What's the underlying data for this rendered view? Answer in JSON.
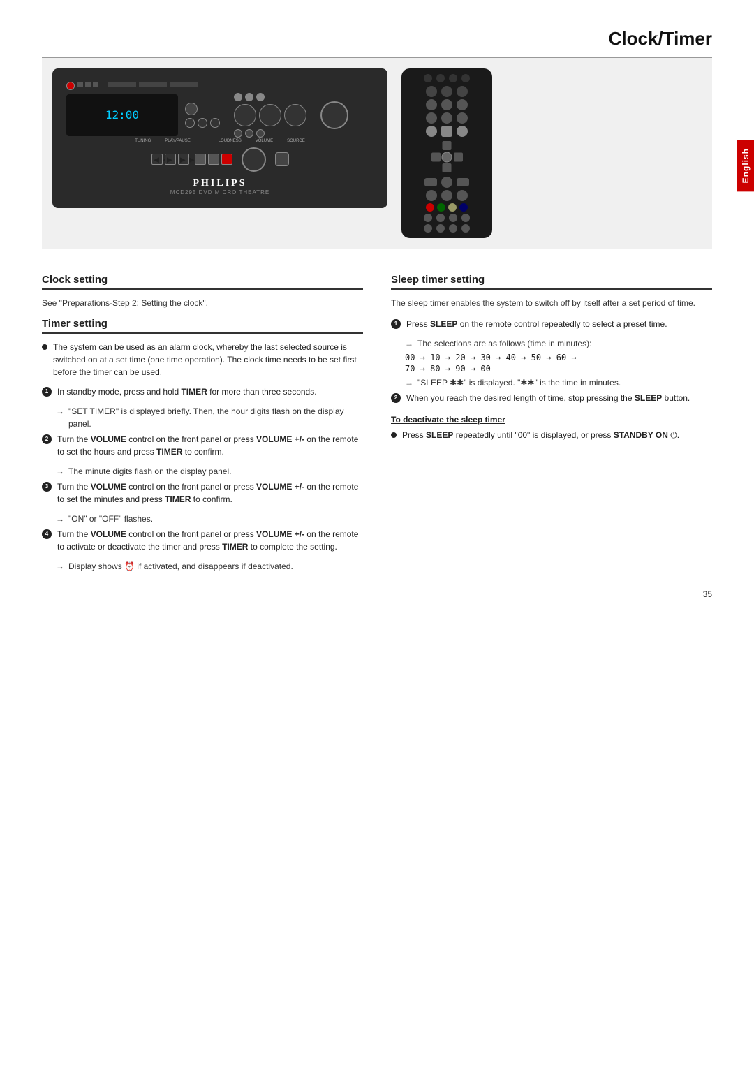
{
  "page": {
    "title": "Clock/Timer",
    "language_tab": "English",
    "page_number": "35"
  },
  "device": {
    "model": "MCD295 DVD MICRO THEATRE",
    "brand": "PHILIPS",
    "display_text": "12:00"
  },
  "clock_setting": {
    "title": "Clock setting",
    "text": "See \"Preparations-Step 2: Setting the clock\"."
  },
  "timer_setting": {
    "title": "Timer setting",
    "bullet0": {
      "text": "The system can be used as an alarm clock, whereby the last selected source is switched on at a set time (one time operation). The clock time needs to be set first before the timer can be used."
    },
    "bullet1": {
      "number": "1",
      "text": "In standby mode, press and hold TIMER for more than three seconds.",
      "arrow1": "→ \"SET TIMER\" is displayed briefly. Then, the hour digits flash on the display panel."
    },
    "bullet2": {
      "number": "2",
      "text": "Turn the VOLUME control on the front panel or press VOLUME +/- on the remote to set the hours and press TIMER to confirm.",
      "arrow1": "→ The minute digits flash on the display panel."
    },
    "bullet3": {
      "number": "3",
      "text": "Turn the VOLUME control on the front panel or press VOLUME +/- on the remote to set the minutes and press TIMER to confirm.",
      "arrow1": "→ \"ON\" or \"OFF\" flashes."
    },
    "bullet4": {
      "number": "4",
      "text": "Turn the VOLUME control on the front panel or press VOLUME +/- on the remote to activate or deactivate the timer and press TIMER to complete the setting.",
      "arrow1": "→ Display shows ⏰ if activated, and disappears if deactivated."
    }
  },
  "sleep_timer": {
    "title": "Sleep timer setting",
    "intro": "The sleep timer enables the system to switch off by itself after a set period of time.",
    "bullet1": {
      "number": "1",
      "text": "Press SLEEP on the remote control repeatedly to select a preset time.",
      "arrow1": "→ The selections are as follows (time in minutes):",
      "sequence1": "00 → 10 → 20 → 30 → 40 → 50 → 60 →",
      "sequence2": "70 → 80 → 90 → 00",
      "arrow2": "→ \"SLEEP ✱✱\" is displayed. \"✱✱\" is the time in minutes."
    },
    "bullet2": {
      "number": "2",
      "text": "When you reach the desired length of time, stop pressing the SLEEP button."
    },
    "deactivate": {
      "heading": "To deactivate the sleep timer",
      "text": "Press SLEEP repeatedly until \"00\" is displayed, or press STANDBY ON ⏻."
    }
  }
}
